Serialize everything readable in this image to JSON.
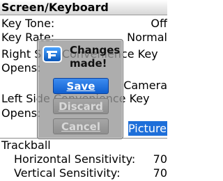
{
  "header": {
    "title": "Screen/Keyboard"
  },
  "settings": {
    "key_tone": {
      "label": "Key Tone:",
      "value": "Off"
    },
    "key_rate": {
      "label": "Key Rate:",
      "value": "Normal"
    },
    "right_side": {
      "label": "Right Side Convenience Key",
      "opens_label": "Opens:",
      "value": ""
    },
    "left_side": {
      "label": "Left Side Convenience Key",
      "opens_label": "Opens:",
      "value": "Camera",
      "selected_value": "Picture It"
    },
    "trackball": {
      "label": "Trackball",
      "horizontal": {
        "label": "Horizontal Sensitivity:",
        "value": "70"
      },
      "vertical": {
        "label": "Vertical Sensitivity:",
        "value": "70"
      }
    }
  },
  "dialog": {
    "icon": "app-icon",
    "message_line1": "Changes",
    "message_line2": "made!",
    "buttons": {
      "save": "Save",
      "discard": "Discard",
      "cancel": "Cancel"
    }
  },
  "colors": {
    "accent": "#1e6fd9",
    "dialog_bg": "#969696"
  }
}
